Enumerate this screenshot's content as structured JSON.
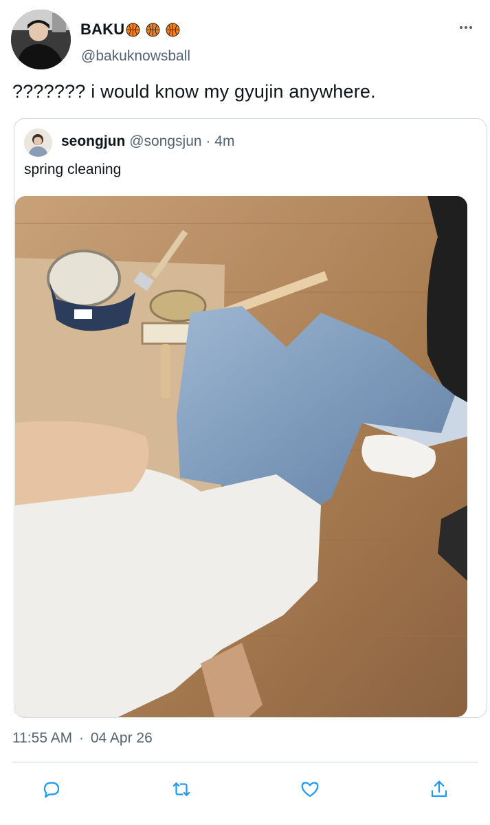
{
  "author": {
    "display_name": "BAKU",
    "name_emoji": [
      "basketball-icon",
      "basketball-icon",
      "basketball-icon"
    ],
    "handle": "@bakuknowsball"
  },
  "tweet": {
    "text": "??????? i would know my gyujin anywhere."
  },
  "quoted": {
    "name": "seongjun",
    "handle": "@songsjun",
    "separator": "·",
    "time": "4m",
    "text": "spring cleaning"
  },
  "meta": {
    "time": "11:55 AM",
    "separator": "·",
    "date": "04 Apr 26"
  },
  "actions": [
    "reply-icon",
    "retweet-icon",
    "like-icon",
    "share-icon"
  ],
  "colors": {
    "text": "#0f1419",
    "secondary": "#536471",
    "border": "#cfd9de",
    "icon": "#1d9bf0"
  }
}
